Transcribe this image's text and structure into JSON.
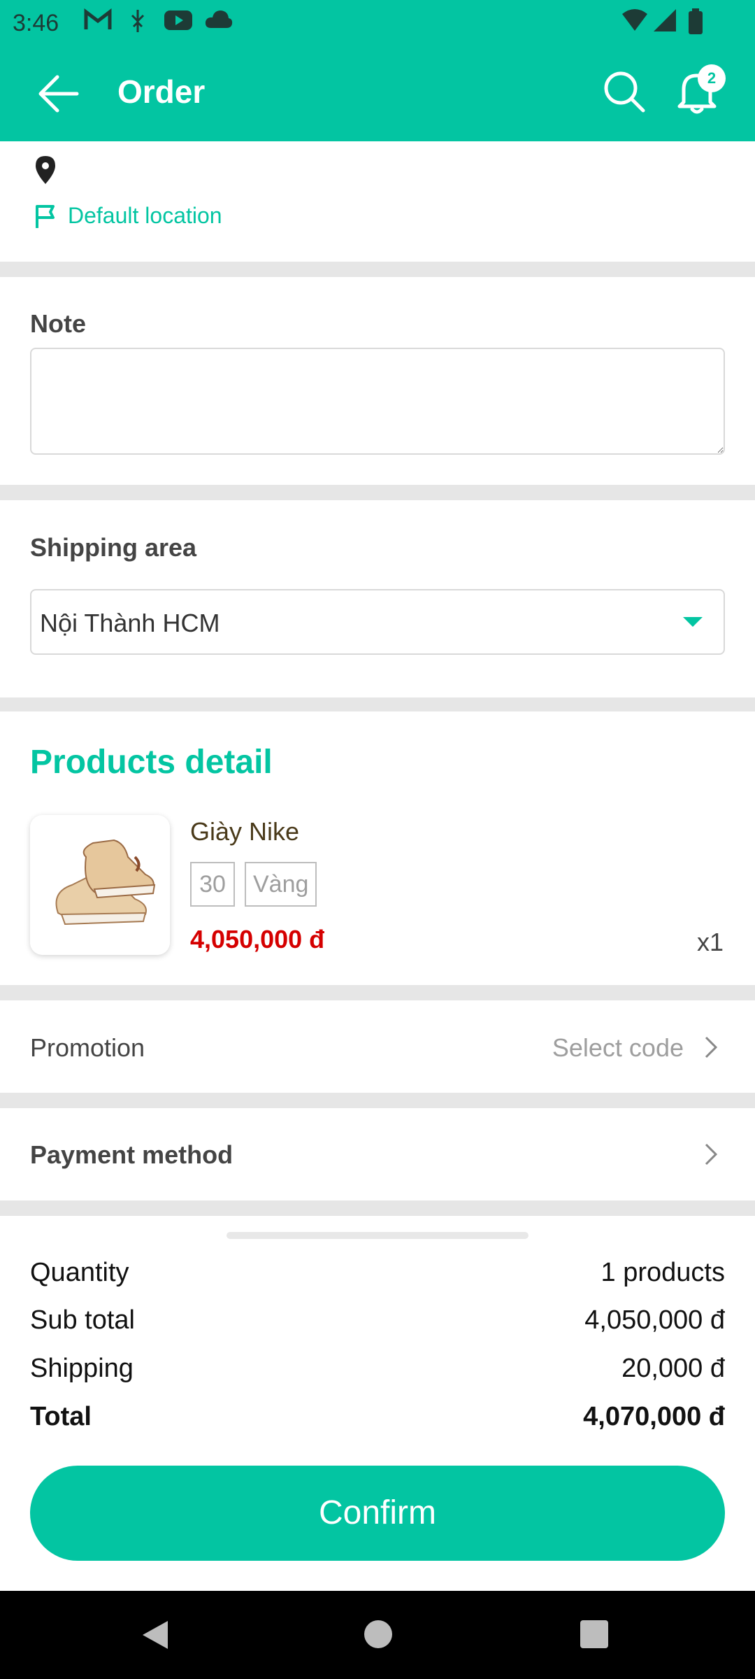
{
  "status_bar": {
    "time": "3:46",
    "icons": [
      "gmail-icon",
      "usb-icon",
      "youtube-icon",
      "cloud-icon",
      "wifi-icon",
      "signal-icon",
      "battery-icon"
    ]
  },
  "header": {
    "title": "Order",
    "notification_count": "2",
    "accent_color": "#03C5A2"
  },
  "location": {
    "default_label": "Default location"
  },
  "note": {
    "label": "Note",
    "value": ""
  },
  "shipping_area": {
    "label": "Shipping area",
    "selected": "Nội Thành HCM"
  },
  "products": {
    "title": "Products detail",
    "items": [
      {
        "name": "Giày Nike",
        "size": "30",
        "color": "Vàng",
        "price": "4,050,000 đ",
        "quantity": "x1"
      }
    ]
  },
  "promotion": {
    "label": "Promotion",
    "hint": "Select code"
  },
  "payment": {
    "label": "Payment method"
  },
  "summary": {
    "quantity_label": "Quantity",
    "quantity_value": "1 products",
    "subtotal_label": "Sub total",
    "subtotal_value": "4,050,000 đ",
    "shipping_label": "Shipping",
    "shipping_value": "20,000 đ",
    "total_label": "Total",
    "total_value": "4,070,000 đ"
  },
  "actions": {
    "confirm_label": "Confirm"
  }
}
